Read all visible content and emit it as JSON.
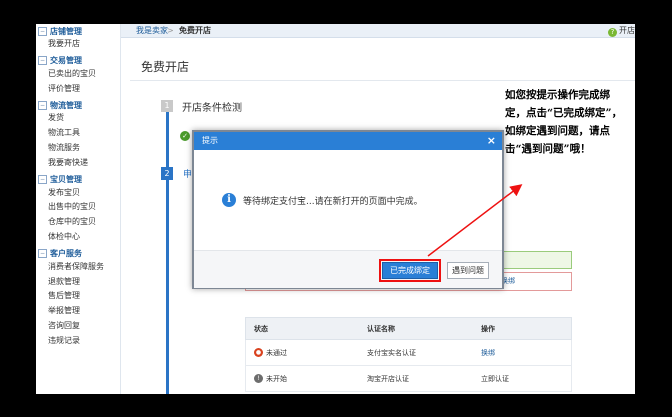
{
  "sidebar": {
    "sections": [
      {
        "title": "店铺管理",
        "items": [
          "我要开店"
        ]
      },
      {
        "title": "交易管理",
        "items": [
          "已卖出的宝贝",
          "评价管理"
        ]
      },
      {
        "title": "物流管理",
        "items": [
          "发货",
          "物流工具",
          "物流服务",
          "我要寄快递"
        ]
      },
      {
        "title": "宝贝管理",
        "items": [
          "发布宝贝",
          "出售中的宝贝",
          "仓库中的宝贝",
          "体检中心"
        ]
      },
      {
        "title": "客户服务",
        "items": [
          "消费者保障服务",
          "退款管理",
          "售后管理",
          "举报管理",
          "咨询回复",
          "违规记录"
        ]
      }
    ]
  },
  "topbar": {
    "crumb_home": "我是卖家",
    "crumb_sep": ">",
    "crumb_current": "免费开店",
    "help_label": "开店"
  },
  "main": {
    "page_title": "免费开店",
    "step1": {
      "num": "1",
      "label": "开店条件检测"
    },
    "step2": {
      "num": "2",
      "label": "申"
    },
    "rebind_link": "换绑"
  },
  "table": {
    "headers": [
      "状态",
      "认证名称",
      "操作"
    ],
    "rows": [
      {
        "status": "未通过",
        "status_color": "#d9421f",
        "name": "支付宝实名认证",
        "action": "换绑",
        "action_link": true
      },
      {
        "status": "未开始",
        "status_color": "#6d6d6d",
        "name": "淘宝开店认证",
        "action": "立即认证",
        "action_link": false
      }
    ]
  },
  "modal": {
    "title": "提示",
    "close": "×",
    "message": "等待绑定支付宝...请在新打开的页面中完成。",
    "confirm": "已完成绑定",
    "problem": "遇到问题"
  },
  "annotation": {
    "text": "如您按提示操作完成绑定，点击“已完成绑定”，如绑定遇到问题，请点击“遇到问题”哦！",
    "arrow_color": "#e11"
  }
}
